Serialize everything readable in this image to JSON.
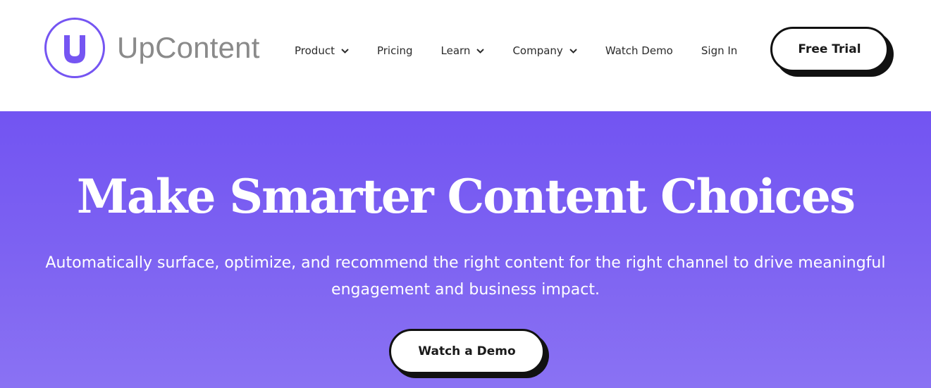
{
  "brand": {
    "name": "UpContent",
    "logo_letter": "U",
    "accent_color": "#7555f2"
  },
  "nav": {
    "items": [
      {
        "label": "Product",
        "has_dropdown": true
      },
      {
        "label": "Pricing",
        "has_dropdown": false
      },
      {
        "label": "Learn",
        "has_dropdown": true
      },
      {
        "label": "Company",
        "has_dropdown": true
      },
      {
        "label": "Watch Demo",
        "has_dropdown": false
      },
      {
        "label": "Sign In",
        "has_dropdown": false
      }
    ],
    "cta_label": "Free Trial"
  },
  "hero": {
    "title": "Make Smarter Content Choices",
    "subtitle": "Automatically surface, optimize, and recommend the right content for the right channel to drive meaningful engagement and business impact.",
    "cta_label": "Watch a Demo",
    "background_color": "#7a5ef2"
  },
  "icons": [
    "upcontent-logo-icon",
    "chevron-down-icon"
  ]
}
